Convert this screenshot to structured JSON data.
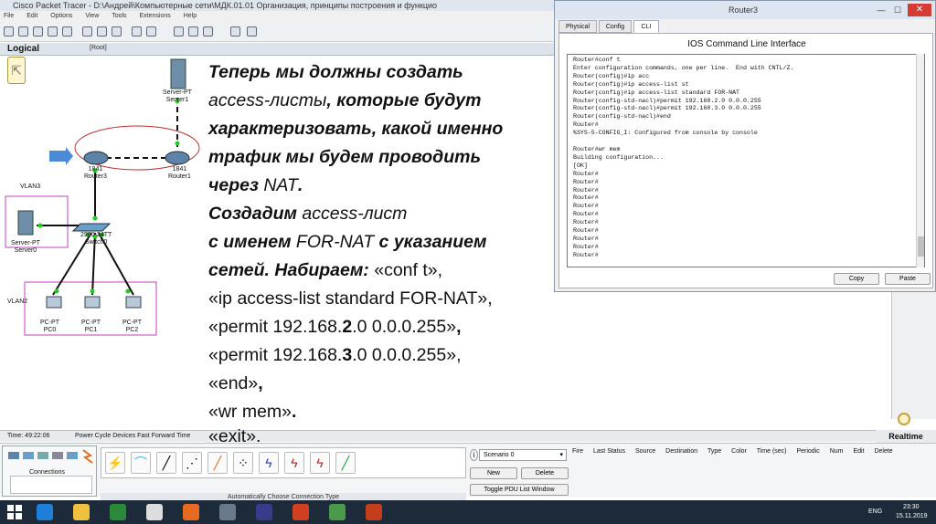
{
  "titlebar": {
    "title": "Cisco Packet Tracer - D:\\Андрей\\Компьютерные сети\\МДК.01.01 Организация, принципы построения и функцио"
  },
  "menu": {
    "items": [
      "File",
      "Edit",
      "Options",
      "View",
      "Tools",
      "Extensions",
      "Help"
    ]
  },
  "workspace": {
    "logical_label": "Logical",
    "root_label": "[Root]"
  },
  "topology": {
    "server1": {
      "label1": "Server-PT",
      "label2": "Server1"
    },
    "router3": {
      "label1": "1841",
      "label2": "Router3"
    },
    "router1": {
      "label1": "1841",
      "label2": "Router1"
    },
    "vlan3": "VLAN3",
    "vlan2": "VLAN2",
    "server0": {
      "label1": "Server-PT",
      "label2": "Server0"
    },
    "switch0": {
      "label1": "2960-24TT",
      "label2": "Switch0"
    },
    "pc0": {
      "label1": "PC-PT",
      "label2": "PC0"
    },
    "pc1": {
      "label1": "PC-PT",
      "label2": "PC1"
    },
    "pc2": {
      "label1": "PC-PT",
      "label2": "PC2"
    }
  },
  "overlay_text": {
    "l1": "Теперь мы должны создать",
    "l2a": "access-листы",
    "l2b": ", которые будут",
    "l3": "характеризовать, какой именно",
    "l4": "трафик мы будем проводить",
    "l5a": "через ",
    "l5b": "NAT",
    "l5c": ".",
    "l6a": "Создадим ",
    "l6b": "access-лист",
    "l7a": "с именем ",
    "l7b": "FOR-NAT",
    "l7c": " с указанием",
    "l8a": "сетей. Набираем: ",
    "l8b": "«conf t»,",
    "l9": "«ip access-list standard FOR-NAT»,",
    "l10a": "«permit 192.168.",
    "l10b": "2",
    "l10c": ".0 0.0.0.255»",
    "l10d": ",",
    "l11a": "«permit 192.168.",
    "l11b": "3",
    "l11c": ".0 0.0.0.255»,",
    "l12a": "«end»",
    "l12b": ",",
    "l13a": "«wr mem»",
    "l13b": ".",
    "l14": "«exit»."
  },
  "router3_window": {
    "title": "Router3",
    "tabs": [
      "Physical",
      "Config",
      "CLI"
    ],
    "heading": "IOS Command Line Interface",
    "cli_lines": [
      "Router#conf t",
      "Enter configuration commands, one per line.  End with CNTL/Z.",
      "Router(config)#ip acc",
      "Router(config)#ip access-list st",
      "Router(config)#ip access-list standard FOR-NAT",
      "Router(config-std-nacl)#permit 192.168.2.0 0.0.0.255",
      "Router(config-std-nacl)#permit 192.168.3.0 0.0.0.255",
      "Router(config-std-nacl)#end",
      "Router#",
      "%SYS-5-CONFIG_I: Configured from console by console",
      "",
      "Router#wr mem",
      "Building configuration...",
      "[OK]",
      "Router#",
      "Router#",
      "Router#",
      "Router#",
      "Router#",
      "Router#",
      "Router#",
      "Router#",
      "Router#",
      "Router#",
      "Router#"
    ],
    "copy": "Copy",
    "paste": "Paste"
  },
  "statusbar": {
    "time": "Time: 49:22:06",
    "power": "Power Cycle Devices  Fast Forward Time",
    "realtime": "Realtime"
  },
  "bottom": {
    "connections": "Connections",
    "auto_conn": "Automatically Choose Connection Type",
    "scenario": "Scenario 0",
    "new": "New",
    "delete": "Delete",
    "toggle": "Toggle PDU List Window",
    "pdu_headers": [
      "Fire",
      "Last Status",
      "Source",
      "Destination",
      "Type",
      "Color",
      "Time (sec)",
      "Periodic",
      "Num",
      "Edit",
      "Delete"
    ]
  },
  "taskbar": {
    "lang": "ENG",
    "time": "23:30",
    "date": "15.11.2019"
  }
}
